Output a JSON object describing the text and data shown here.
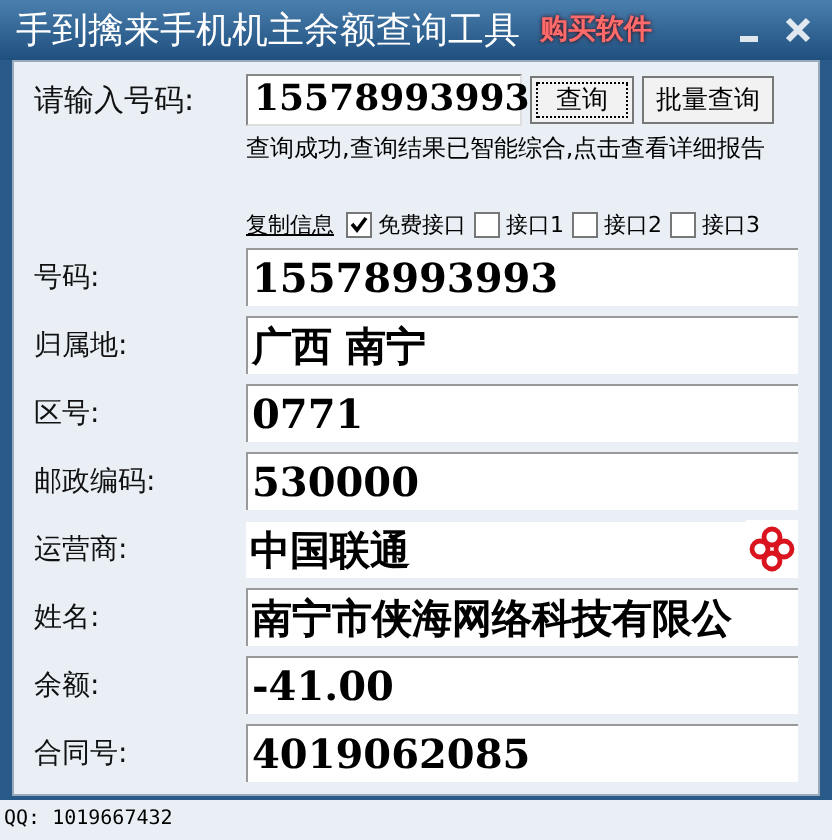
{
  "window": {
    "title": "手到擒来手机机主余额查询工具",
    "link": "购买软件"
  },
  "query": {
    "label": "请输入号码:",
    "value": "15578993993",
    "buttons": [
      "查询",
      "批量查询"
    ],
    "message": "查询成功,查询结果已智能综合,点击查看详细报告"
  },
  "copy_link": "复制信息",
  "interfaces": [
    {
      "label": "免费接口",
      "checked": true
    },
    {
      "label": "接口1",
      "checked": false
    },
    {
      "label": "接口2",
      "checked": false
    },
    {
      "label": "接口3",
      "checked": false
    }
  ],
  "fields": [
    {
      "label": "号码:",
      "value": "15578993993"
    },
    {
      "label": "归属地:",
      "value": "广西  南宁"
    },
    {
      "label": "区号:",
      "value": "0771"
    },
    {
      "label": "邮政编码:",
      "value": "530000"
    },
    {
      "label": "运营商:",
      "value": "中国联通",
      "kind": "carrier"
    },
    {
      "label": "姓名:",
      "value": "南宁市侠海网络科技有限公"
    },
    {
      "label": "余额:",
      "value": "-41.00"
    },
    {
      "label": "合同号:",
      "value": "4019062085"
    }
  ],
  "status_bar": "QQ: 1019667432"
}
